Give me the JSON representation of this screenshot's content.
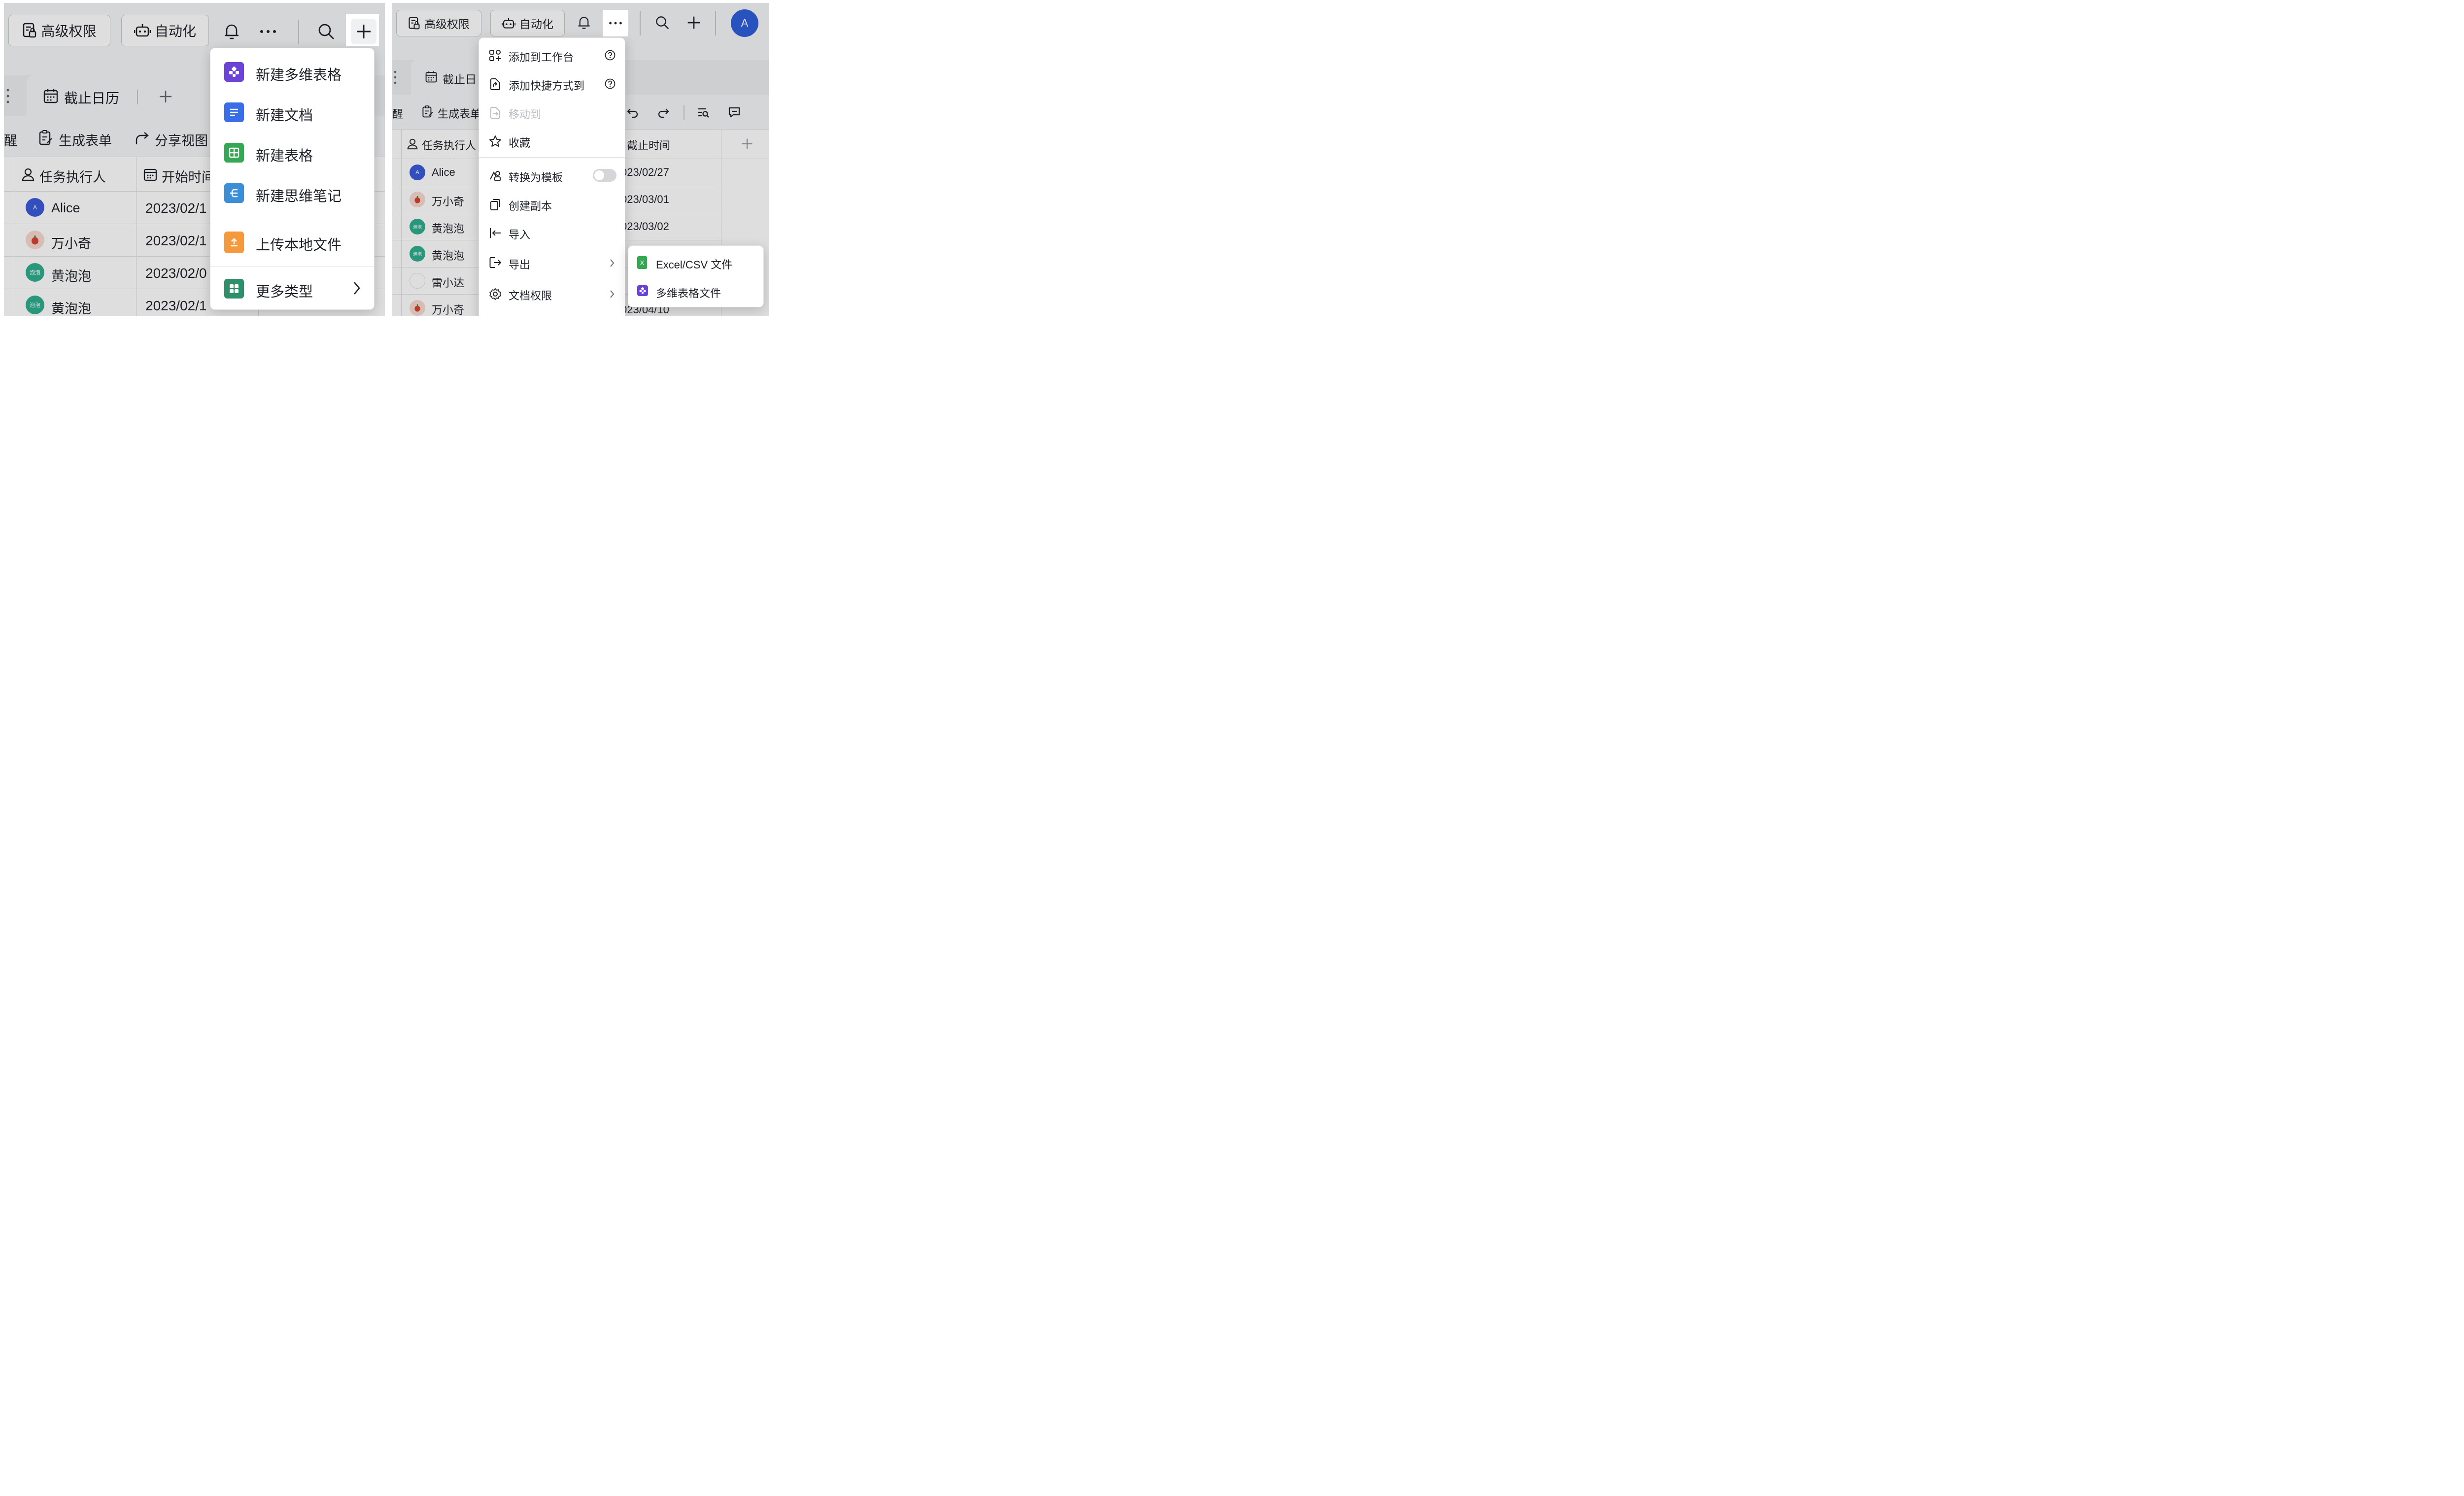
{
  "left": {
    "toolbar": {
      "permission_label": "高级权限",
      "automation_label": "自动化"
    },
    "tabs": [
      {
        "label": "截止日历"
      }
    ],
    "actions": [
      {
        "label": "醒"
      },
      {
        "label": "生成表单"
      },
      {
        "label": "分享视图"
      }
    ],
    "columns": [
      {
        "label": "任务执行人"
      },
      {
        "label": "开始时间"
      }
    ],
    "rows": [
      {
        "name": "Alice",
        "avatar": "A",
        "date": "2023/02/1"
      },
      {
        "name": "万小奇",
        "avatar": "",
        "date": "2023/02/1"
      },
      {
        "name": "黄泡泡",
        "avatar": "泡泡",
        "date": "2023/02/0"
      },
      {
        "name": "黄泡泡",
        "avatar": "泡泡",
        "date": "2023/02/1"
      }
    ],
    "create_menu": {
      "items": [
        {
          "label": "新建多维表格",
          "icon": "bitable-icon",
          "color": "#6b43d6"
        },
        {
          "label": "新建文档",
          "icon": "doc-icon",
          "color": "#3a6ee8"
        },
        {
          "label": "新建表格",
          "icon": "sheet-icon",
          "color": "#34a853"
        },
        {
          "label": "新建思维笔记",
          "icon": "mindnote-icon",
          "color": "#3c8fd6"
        },
        {
          "label": "上传本地文件",
          "icon": "upload-file-icon",
          "color": "#f59a3c"
        },
        {
          "label": "更多类型",
          "icon": "more-types-icon",
          "color": "#2f8f6a"
        }
      ]
    }
  },
  "right": {
    "toolbar": {
      "permission_label": "高级权限",
      "automation_label": "自动化",
      "avatar": "A"
    },
    "tabs": [
      {
        "label": "截止日"
      }
    ],
    "actions": [
      {
        "label": "醒"
      },
      {
        "label": "生成表单"
      }
    ],
    "columns": [
      {
        "label": "任务执行人"
      },
      {
        "label": "截止时间"
      }
    ],
    "rows": [
      {
        "name": "Alice",
        "avatar": "A",
        "date": "023/02/27"
      },
      {
        "name": "万小奇",
        "avatar": "",
        "date": "023/03/01"
      },
      {
        "name": "黄泡泡",
        "avatar": "泡泡",
        "date": "023/03/02"
      },
      {
        "name": "黄泡泡",
        "avatar": "泡泡",
        "date": ""
      },
      {
        "name": "雷小达",
        "avatar": "",
        "date": ""
      },
      {
        "name": "万小奇",
        "avatar": "",
        "date": "023/04/10"
      }
    ],
    "more_menu": {
      "items": [
        {
          "label": "添加到工作台",
          "icon": "workspace-add-icon"
        },
        {
          "label": "添加快捷方式到",
          "icon": "shortcut-icon"
        },
        {
          "label": "移动到",
          "icon": "move-icon"
        },
        {
          "label": "收藏",
          "icon": "star-icon"
        },
        {
          "label": "转换为模板",
          "icon": "template-icon"
        },
        {
          "label": "创建副本",
          "icon": "copy-icon"
        },
        {
          "label": "导入",
          "icon": "import-icon"
        },
        {
          "label": "导出",
          "icon": "export-icon"
        },
        {
          "label": "文档权限",
          "icon": "gear-icon"
        }
      ]
    },
    "export_submenu": {
      "items": [
        {
          "label": "Excel/CSV 文件",
          "icon": "excel-icon",
          "icon_letter": "X"
        },
        {
          "label": "多维表格文件",
          "icon": "bitable-icon"
        }
      ]
    }
  }
}
